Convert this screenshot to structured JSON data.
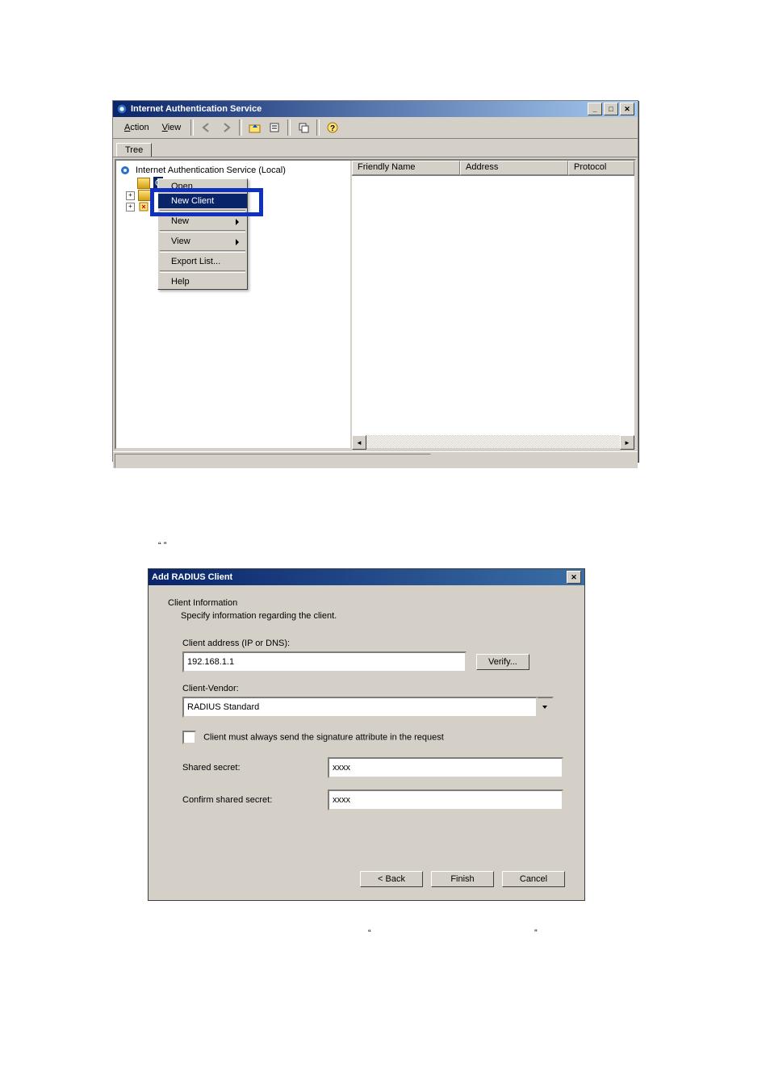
{
  "window1": {
    "title": "Internet Authentication Service",
    "menus": {
      "action": "Action",
      "view": "View"
    },
    "tab": "Tree",
    "root_node": "Internet Authentication Service (Local)",
    "selected_node_initial": "C",
    "context_menu": {
      "open": "Open",
      "new_client": "New Client",
      "new": "New",
      "view": "View",
      "export": "Export List...",
      "help": "Help"
    },
    "columns": {
      "friendly": "Friendly Name",
      "address": "Address",
      "protocol": "Protocol"
    }
  },
  "doc_text": {
    "between": "“            ”",
    "below_left": "“",
    "below_right": "”"
  },
  "dialog": {
    "title": "Add RADIUS Client",
    "heading": "Client Information",
    "subheading": "Specify information regarding the client.",
    "addr_label": "Client address (IP or DNS):",
    "addr_value": "192.168.1.1",
    "verify_btn": "Verify...",
    "vendor_label": "Client-Vendor:",
    "vendor_value": "RADIUS Standard",
    "signature_checkbox": "Client must always send the signature attribute in the request",
    "shared_label": "Shared secret:",
    "shared_value": "xxxx",
    "confirm_label": "Confirm shared secret:",
    "confirm_value": "xxxx",
    "back_btn": "< Back",
    "finish_btn": "Finish",
    "cancel_btn": "Cancel"
  }
}
